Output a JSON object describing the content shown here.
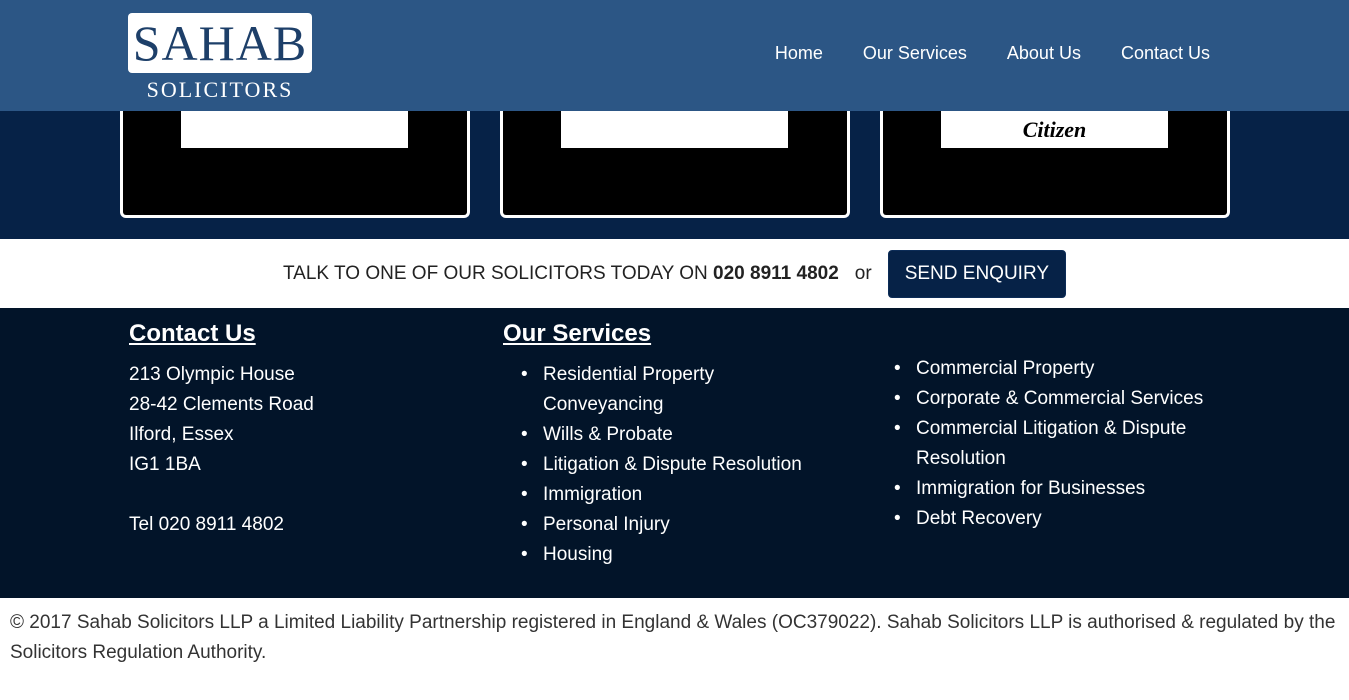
{
  "header": {
    "logo_main": "SAHAB",
    "logo_sub": "SOLICITORS",
    "nav": [
      "Home",
      "Our Services",
      "About Us",
      "Contact Us"
    ]
  },
  "cards": [
    {
      "label": ""
    },
    {
      "label": ""
    },
    {
      "label": "Citizen"
    }
  ],
  "callbar": {
    "text": "TALK TO ONE OF OUR SOLICITORS TODAY ON ",
    "phone": "020 8911 4802",
    "or": "or",
    "button": "SEND ENQUIRY"
  },
  "footer": {
    "contact_title": "Contact Us",
    "address": [
      "213 Olympic House",
      "28-42 Clements Road",
      "Ilford, Essex",
      "IG1 1BA",
      "",
      "Tel 020 8911 4802"
    ],
    "services_title": "Our Services",
    "services_1": [
      "Residential Property Conveyancing",
      "Wills & Probate",
      "Litigation & Dispute Resolution",
      "Immigration",
      "Personal Injury",
      "Housing"
    ],
    "services_2": [
      "Commercial Property",
      "Corporate & Commercial Services",
      "Commercial Litigation & Dispute Resolution",
      "Immigration for Businesses",
      "Debt Recovery"
    ]
  },
  "copyright": "© 2017 Sahab Solicitors LLP a Limited Liability Partnership registered in England & Wales (OC379022). Sahab Solicitors LLP is authorised & regulated by the Solicitors Regulation Authority."
}
